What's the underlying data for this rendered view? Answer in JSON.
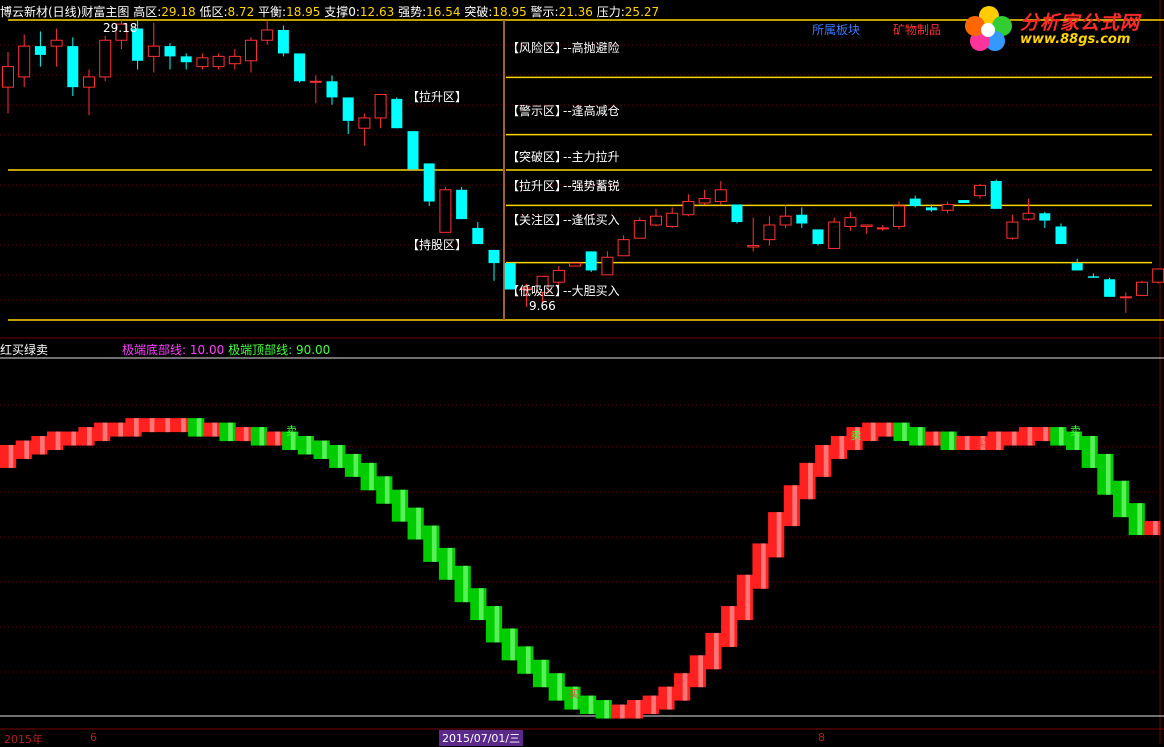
{
  "header": {
    "stock_name": "博云新材(日线)",
    "indicator_name": "财富主图",
    "fields": [
      {
        "label": "高区:",
        "value": "29.18"
      },
      {
        "label": "低区:",
        "value": "8.72"
      },
      {
        "label": "平衡:",
        "value": "18.95"
      },
      {
        "label": "支撑0:",
        "value": "12.63"
      },
      {
        "label": "强势:",
        "value": "16.54"
      },
      {
        "label": "突破:",
        "value": "18.95"
      },
      {
        "label": "警示:",
        "value": "21.36"
      },
      {
        "label": "压力:",
        "value": "25.27"
      }
    ],
    "sector_label": "所属板块",
    "sector_value": "矿物制品"
  },
  "logo": {
    "text": "分析家公式网",
    "url": "www.88gs.com"
  },
  "annotations": {
    "high_marker": "29.18",
    "low_marker": "9.66",
    "zone_pull_up": "【拉升区】",
    "zone_hold": "【持股区】",
    "legend": [
      {
        "tag": "【风险区】",
        "desc": "--高抛避险"
      },
      {
        "tag": "【警示区】",
        "desc": "--逢高减仓"
      },
      {
        "tag": "【突破区】",
        "desc": "--主力拉升"
      },
      {
        "tag": "【拉升区】",
        "desc": "--强势蓄锐"
      },
      {
        "tag": "【关注区】",
        "desc": "--逢低买入"
      },
      {
        "tag": "【低吸区】",
        "desc": "--大胆买入"
      }
    ]
  },
  "lower_panel": {
    "title": "红买绿卖",
    "bottom_label": "极端底部线:",
    "bottom_value": "10.00",
    "top_label": "极端顶部线:",
    "top_value": "90.00",
    "signal_sell": "卖",
    "signal_buy": "买"
  },
  "footer": {
    "year_label": "2015年",
    "tick_6": "6",
    "date_label": "2015/07/01/三",
    "tick_8": "8"
  },
  "colors": {
    "up": "#ff3232",
    "down": "#00ffff",
    "level_line": "#ffd400",
    "buy_bar": "#ff2020",
    "sell_bar": "#00cc00",
    "header_value": "#ffd400",
    "magenta": "#ff40ff",
    "green_text": "#40ff40"
  },
  "chart_data": [
    {
      "type": "candlestick",
      "title": "博云新材(日线) 财富主图",
      "ylim": [
        8.72,
        29.18
      ],
      "levels": [
        {
          "name": "高区",
          "value": 29.18
        },
        {
          "name": "压力",
          "value": 25.27
        },
        {
          "name": "警示",
          "value": 21.36
        },
        {
          "name": "突破",
          "value": 18.95
        },
        {
          "name": "强势",
          "value": 16.54
        },
        {
          "name": "支撑0",
          "value": 12.63
        },
        {
          "name": "低区",
          "value": 8.72
        }
      ],
      "candles": [
        [
          24.6,
          26.0,
          27.0,
          22.8
        ],
        [
          25.3,
          27.4,
          28.2,
          24.6
        ],
        [
          27.4,
          26.8,
          28.4,
          26.0
        ],
        [
          27.4,
          27.8,
          28.6,
          26.0
        ],
        [
          27.4,
          24.6,
          28.0,
          24.0
        ],
        [
          24.6,
          25.3,
          25.8,
          22.7
        ],
        [
          25.3,
          27.8,
          28.1,
          25.0
        ],
        [
          27.8,
          28.9,
          29.2,
          27.2
        ],
        [
          28.6,
          26.4,
          29.2,
          25.8
        ],
        [
          26.7,
          27.4,
          29.0,
          25.6
        ],
        [
          27.4,
          26.7,
          27.6,
          25.8
        ],
        [
          26.7,
          26.3,
          26.9,
          25.8
        ],
        [
          26.0,
          26.6,
          26.9,
          25.8
        ],
        [
          26.0,
          26.7,
          26.9,
          25.8
        ],
        [
          26.2,
          26.7,
          27.2,
          25.8
        ],
        [
          26.4,
          27.8,
          28.0,
          25.6
        ],
        [
          27.8,
          28.5,
          29.2,
          27.5
        ],
        [
          28.5,
          26.9,
          28.8,
          26.7
        ],
        [
          26.9,
          25.0,
          26.9,
          24.9
        ],
        [
          25.0,
          25.0,
          25.4,
          23.5
        ],
        [
          25.0,
          23.9,
          25.4,
          23.4
        ],
        [
          23.9,
          22.3,
          23.9,
          21.4
        ],
        [
          21.8,
          22.5,
          22.8,
          20.6
        ],
        [
          22.5,
          24.1,
          23.9,
          21.8
        ],
        [
          23.8,
          21.8,
          23.9,
          21.8
        ],
        [
          21.6,
          19.0,
          21.6,
          18.9
        ],
        [
          19.4,
          16.8,
          19.4,
          16.5
        ],
        [
          14.7,
          17.6,
          17.8,
          14.7
        ],
        [
          17.6,
          15.6,
          17.8,
          15.6
        ],
        [
          15.0,
          13.9,
          15.4,
          13.9
        ],
        [
          13.5,
          12.6,
          13.5,
          11.4
        ],
        [
          12.6,
          10.8,
          12.6,
          10.8
        ],
        [
          10.8,
          10.9,
          11.2,
          9.6
        ],
        [
          10.6,
          11.7,
          11.7,
          9.9
        ],
        [
          11.3,
          12.1,
          12.4,
          11.1
        ],
        [
          12.4,
          12.6,
          12.6,
          12.4
        ],
        [
          13.4,
          12.1,
          13.4,
          12.0
        ],
        [
          11.8,
          13.0,
          13.4,
          11.8
        ],
        [
          13.1,
          14.2,
          14.5,
          13.1
        ],
        [
          14.3,
          15.5,
          15.7,
          14.3
        ],
        [
          15.2,
          15.8,
          16.3,
          15.1
        ],
        [
          15.1,
          16.0,
          16.4,
          15.0
        ],
        [
          15.9,
          16.8,
          17.3,
          15.8
        ],
        [
          16.7,
          17.0,
          17.6,
          16.6
        ],
        [
          16.8,
          17.6,
          18.2,
          16.6
        ],
        [
          16.6,
          15.4,
          16.6,
          15.3
        ],
        [
          13.7,
          13.8,
          15.7,
          13.4
        ],
        [
          14.2,
          15.2,
          15.8,
          13.8
        ],
        [
          15.2,
          15.8,
          16.6,
          15.0
        ],
        [
          15.9,
          15.3,
          16.4,
          15.0
        ],
        [
          14.9,
          13.9,
          14.8,
          13.8
        ],
        [
          13.6,
          15.4,
          15.7,
          13.6
        ],
        [
          15.1,
          15.7,
          16.1,
          14.8
        ],
        [
          15.1,
          15.2,
          15.2,
          14.6
        ],
        [
          15.0,
          15.0,
          15.2,
          14.8
        ],
        [
          15.1,
          16.5,
          16.8,
          14.9
        ],
        [
          17.0,
          16.5,
          17.2,
          16.4
        ],
        [
          16.4,
          16.2,
          16.6,
          16.1
        ],
        [
          16.2,
          16.6,
          16.8,
          16.0
        ],
        [
          16.9,
          16.7,
          16.9,
          16.7
        ],
        [
          17.2,
          17.9,
          18.0,
          17.0
        ],
        [
          18.2,
          16.3,
          18.3,
          16.3
        ],
        [
          14.3,
          15.4,
          15.9,
          14.2
        ],
        [
          15.6,
          16.0,
          17.0,
          15.5
        ],
        [
          16.0,
          15.5,
          16.1,
          15.0
        ],
        [
          15.1,
          13.9,
          15.3,
          13.9
        ],
        [
          12.6,
          12.1,
          12.9,
          12.1
        ],
        [
          11.7,
          11.6,
          11.9,
          11.6
        ],
        [
          11.5,
          10.3,
          11.6,
          10.3
        ],
        [
          10.3,
          10.3,
          10.6,
          9.2
        ],
        [
          10.4,
          11.3,
          11.4,
          10.4
        ],
        [
          11.3,
          12.2,
          12.2,
          11.2
        ],
        [
          12.3,
          11.2,
          12.3,
          11.2
        ]
      ]
    },
    {
      "type": "bar",
      "title": "红买绿卖",
      "ylim": [
        0,
        100
      ],
      "reference_lines": [
        {
          "name": "极端底部线",
          "value": 10
        },
        {
          "name": "极端顶部线",
          "value": 90
        }
      ],
      "values": [
        67,
        69,
        70,
        71,
        72,
        72,
        73,
        74,
        74,
        75,
        75,
        75,
        75,
        74,
        74,
        73,
        73,
        72,
        72,
        71,
        70,
        69,
        67,
        65,
        62,
        59,
        55,
        51,
        46,
        42,
        37,
        33,
        28,
        24,
        21,
        18,
        15,
        13,
        12,
        11,
        11,
        12,
        13,
        15,
        18,
        22,
        27,
        33,
        40,
        47,
        54,
        60,
        65,
        69,
        71,
        73,
        74,
        74,
        73,
        72,
        72,
        71,
        71,
        71,
        72,
        72,
        73,
        73,
        72,
        71,
        67,
        61,
        56,
        52
      ],
      "signal_buy_index": [
        36,
        62
      ],
      "signal_sell_index": [
        18,
        54,
        68
      ]
    }
  ]
}
